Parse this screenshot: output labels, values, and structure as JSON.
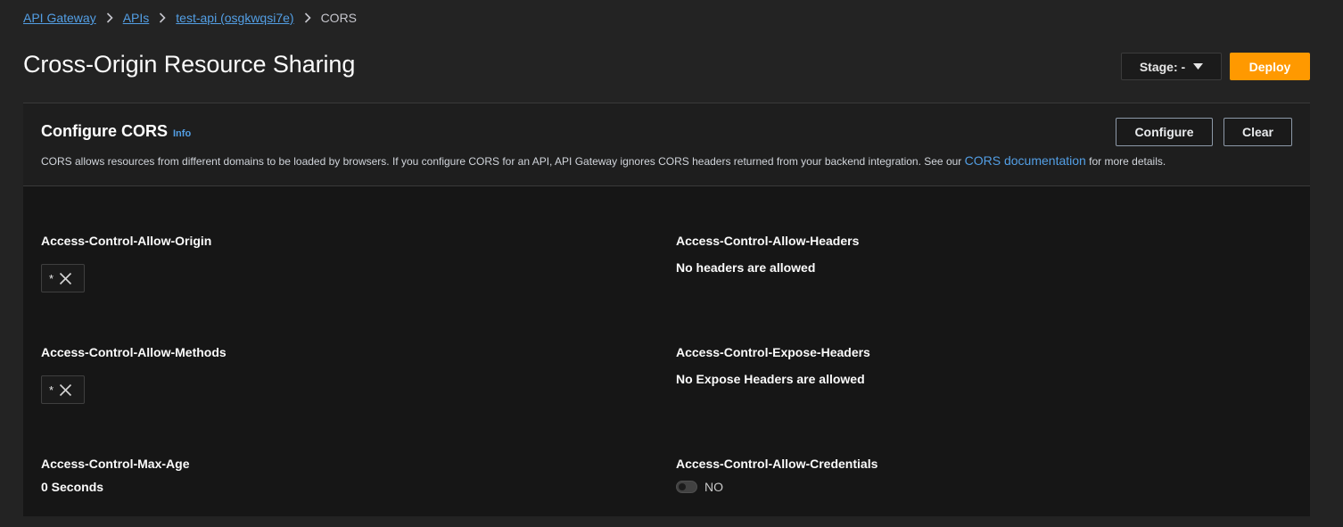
{
  "breadcrumb": {
    "items": [
      "API Gateway",
      "APIs",
      "test-api (osgkwqsi7e)"
    ],
    "current": "CORS"
  },
  "page": {
    "title": "Cross-Origin Resource Sharing",
    "stage_label": "Stage: -",
    "deploy_label": "Deploy"
  },
  "card": {
    "title": "Configure CORS",
    "info_label": "Info",
    "description_prefix": "CORS allows resources from different domains to be loaded by browsers. If you configure CORS for an API, API Gateway ignores CORS headers returned from your backend integration. See our",
    "doc_link": "CORS documentation",
    "description_suffix": "for more details.",
    "configure_label": "Configure",
    "clear_label": "Clear"
  },
  "fields": {
    "allow_origin": {
      "label": "Access-Control-Allow-Origin",
      "token": "*"
    },
    "allow_headers": {
      "label": "Access-Control-Allow-Headers",
      "value": "No headers are allowed"
    },
    "allow_methods": {
      "label": "Access-Control-Allow-Methods",
      "token": "*"
    },
    "expose_headers": {
      "label": "Access-Control-Expose-Headers",
      "value": "No Expose Headers are allowed"
    },
    "max_age": {
      "label": "Access-Control-Max-Age",
      "value": "0 Seconds"
    },
    "allow_credentials": {
      "label": "Access-Control-Allow-Credentials",
      "value": "NO",
      "enabled": false
    }
  },
  "colors": {
    "accent": "#ff9900",
    "link": "#539fe5",
    "background": "#232323",
    "panel": "#161616"
  }
}
